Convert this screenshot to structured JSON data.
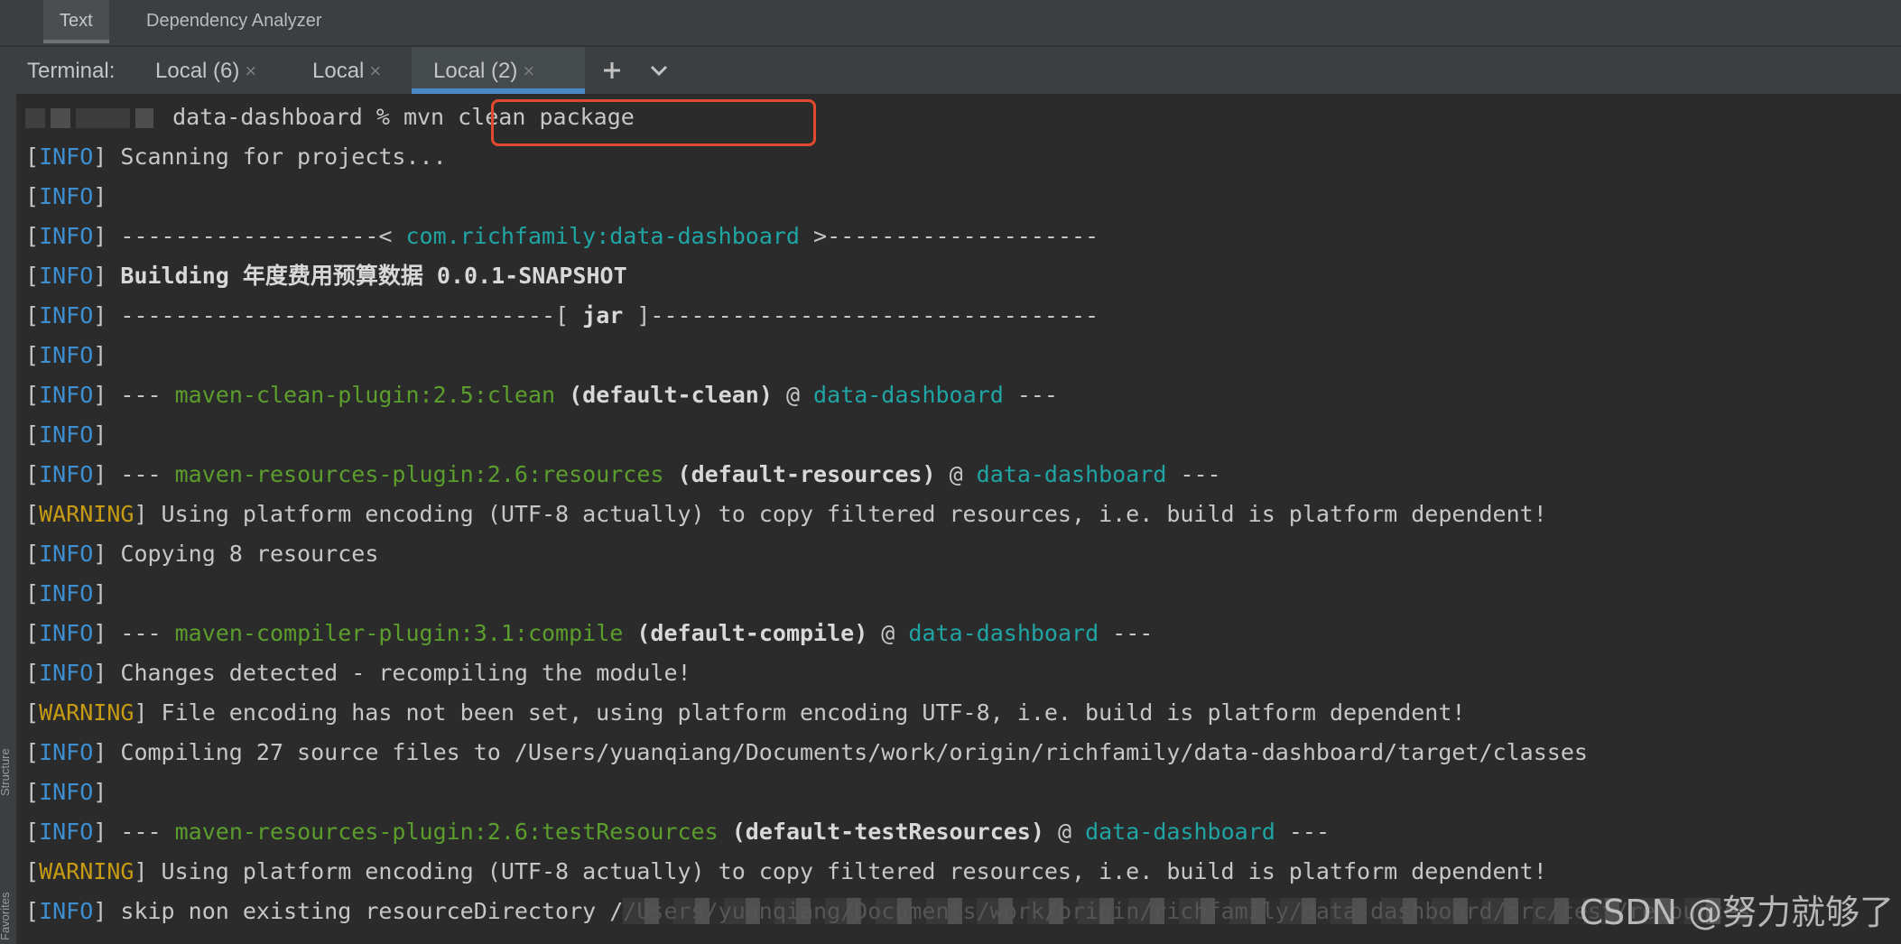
{
  "editor_tabs": [
    "Text",
    "Dependency Analyzer"
  ],
  "terminal": {
    "label": "Terminal:",
    "tabs": [
      {
        "label": "Local (6)",
        "closable": true
      },
      {
        "label": "Local",
        "closable": true
      },
      {
        "label": "Local (2)",
        "closable": true,
        "active": true
      }
    ],
    "close_glyph": "×",
    "add_icon": "plus-icon",
    "menu_icon": "chevron-down-icon"
  },
  "side_labels": [
    "Structure",
    "Favorites"
  ],
  "prompt": {
    "dir": "data-dashboard %",
    "command": "mvn clean package"
  },
  "lines": [
    {
      "level": "INFO",
      "segments": [
        {
          "t": " Scanning for projects...",
          "c": ""
        }
      ]
    },
    {
      "level": "INFO",
      "segments": []
    },
    {
      "level": "INFO",
      "segments": [
        {
          "t": " -------------------< ",
          "c": ""
        },
        {
          "t": "com.richfamily:data-dashboard",
          "c": "cyan"
        },
        {
          "t": " >--------------------",
          "c": ""
        }
      ]
    },
    {
      "level": "INFO",
      "segments": [
        {
          "t": " ",
          "c": ""
        },
        {
          "t": "Building 年度费用预算数据 0.0.1-SNAPSHOT",
          "c": "bold"
        }
      ]
    },
    {
      "level": "INFO",
      "segments": [
        {
          "t": " --------------------------------[ ",
          "c": ""
        },
        {
          "t": "jar",
          "c": "bold"
        },
        {
          "t": " ]---------------------------------",
          "c": ""
        }
      ]
    },
    {
      "level": "INFO",
      "segments": []
    },
    {
      "level": "INFO",
      "segments": [
        {
          "t": " --- ",
          "c": ""
        },
        {
          "t": "maven-clean-plugin:2.5:clean",
          "c": "green"
        },
        {
          "t": " ",
          "c": ""
        },
        {
          "t": "(default-clean)",
          "c": "bold"
        },
        {
          "t": " @ ",
          "c": ""
        },
        {
          "t": "data-dashboard",
          "c": "cyan"
        },
        {
          "t": " ---",
          "c": ""
        }
      ]
    },
    {
      "level": "INFO",
      "segments": []
    },
    {
      "level": "INFO",
      "segments": [
        {
          "t": " --- ",
          "c": ""
        },
        {
          "t": "maven-resources-plugin:2.6:resources",
          "c": "green"
        },
        {
          "t": " ",
          "c": ""
        },
        {
          "t": "(default-resources)",
          "c": "bold"
        },
        {
          "t": " @ ",
          "c": ""
        },
        {
          "t": "data-dashboard",
          "c": "cyan"
        },
        {
          "t": " ---",
          "c": ""
        }
      ]
    },
    {
      "level": "WARNING",
      "segments": [
        {
          "t": " Using platform encoding (UTF-8 actually) to copy filtered resources, i.e. build is platform dependent!",
          "c": ""
        }
      ]
    },
    {
      "level": "INFO",
      "segments": [
        {
          "t": " Copying 8 resources",
          "c": ""
        }
      ]
    },
    {
      "level": "INFO",
      "segments": []
    },
    {
      "level": "INFO",
      "segments": [
        {
          "t": " --- ",
          "c": ""
        },
        {
          "t": "maven-compiler-plugin:3.1:compile",
          "c": "green"
        },
        {
          "t": " ",
          "c": ""
        },
        {
          "t": "(default-compile)",
          "c": "bold"
        },
        {
          "t": " @ ",
          "c": ""
        },
        {
          "t": "data-dashboard",
          "c": "cyan"
        },
        {
          "t": " ---",
          "c": ""
        }
      ]
    },
    {
      "level": "INFO",
      "segments": [
        {
          "t": " Changes detected - recompiling the module!",
          "c": ""
        }
      ]
    },
    {
      "level": "WARNING",
      "segments": [
        {
          "t": " File encoding has not been set, using platform encoding UTF-8, i.e. build is platform dependent!",
          "c": ""
        }
      ]
    },
    {
      "level": "INFO",
      "segments": [
        {
          "t": " Compiling 27 source files to /Users/yuanqiang/Documents/work/origin/richfamily/data-dashboard/target/classes",
          "c": ""
        }
      ]
    },
    {
      "level": "INFO",
      "segments": []
    },
    {
      "level": "INFO",
      "segments": [
        {
          "t": " --- ",
          "c": ""
        },
        {
          "t": "maven-resources-plugin:2.6:testResources",
          "c": "green"
        },
        {
          "t": " ",
          "c": ""
        },
        {
          "t": "(default-testResources)",
          "c": "bold"
        },
        {
          "t": " @ ",
          "c": ""
        },
        {
          "t": "data-dashboard",
          "c": "cyan"
        },
        {
          "t": " ---",
          "c": ""
        }
      ]
    },
    {
      "level": "WARNING",
      "segments": [
        {
          "t": " Using platform encoding (UTF-8 actually) to copy filtered resources, i.e. build is platform dependent!",
          "c": ""
        }
      ]
    },
    {
      "level": "INFO",
      "segments": [
        {
          "t": " skip non existing resourceDirectory /",
          "c": ""
        },
        {
          "t": "/Users/yuanqiang/Documents/work/origin/richfamily/data-dashboard/src/test/resources",
          "c": "redact"
        }
      ]
    }
  ],
  "watermark": "CSDN @努力就够了",
  "colors": {
    "info": "#3d8fd1",
    "warning": "#c79b14",
    "plugin": "#5b9e2d",
    "artifact": "#20a4a4",
    "highlight_box": "#e24a2f",
    "active_tab_underline": "#4a88c7"
  }
}
